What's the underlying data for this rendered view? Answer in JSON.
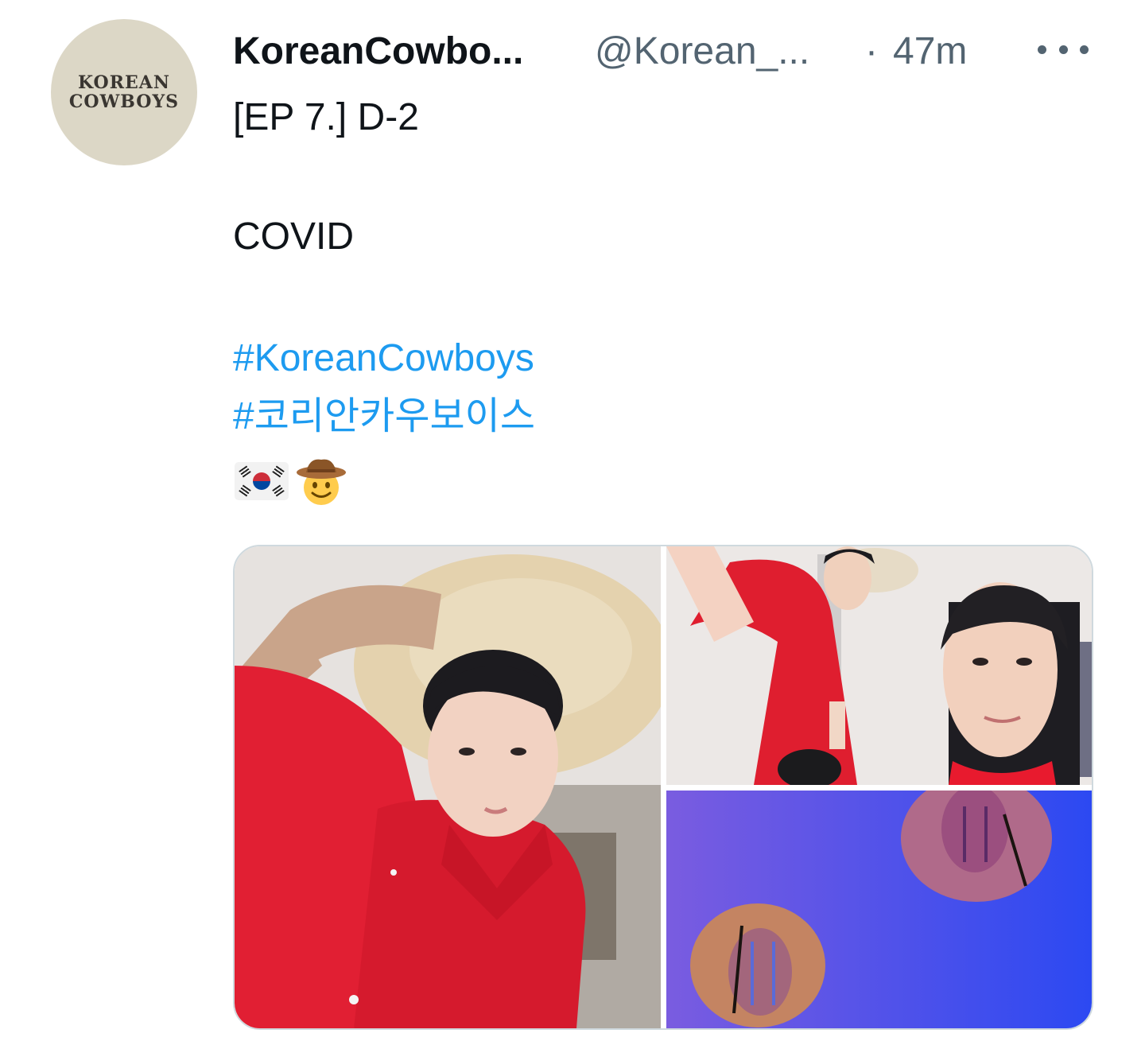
{
  "tweet": {
    "avatar": {
      "logo_line_1": "KOREAN",
      "logo_line_2": "COWBOYS",
      "bg_color": "#dcd7c6"
    },
    "header": {
      "display_name": "KoreanCowbo...",
      "handle": "@Korean_...",
      "separator": "·",
      "time": "47m",
      "more_icon": "more-horizontal-icon"
    },
    "body": {
      "line_1": "[EP 7.] D-2",
      "line_2": "COVID",
      "hashtags": [
        "#KoreanCowboys",
        "#코리안카우보이스"
      ],
      "emojis": [
        "south-korea-flag-emoji",
        "cowboy-hat-face-emoji"
      ]
    },
    "media": {
      "photos": [
        "photo-red-shirt-straw-hat",
        "photo-stretching-and-face",
        "photo-hats-on-wall"
      ]
    },
    "colors": {
      "link": "#1d9bf0",
      "secondary_text": "#536471",
      "primary_text": "#0f1419",
      "border": "#cfd9de"
    }
  }
}
